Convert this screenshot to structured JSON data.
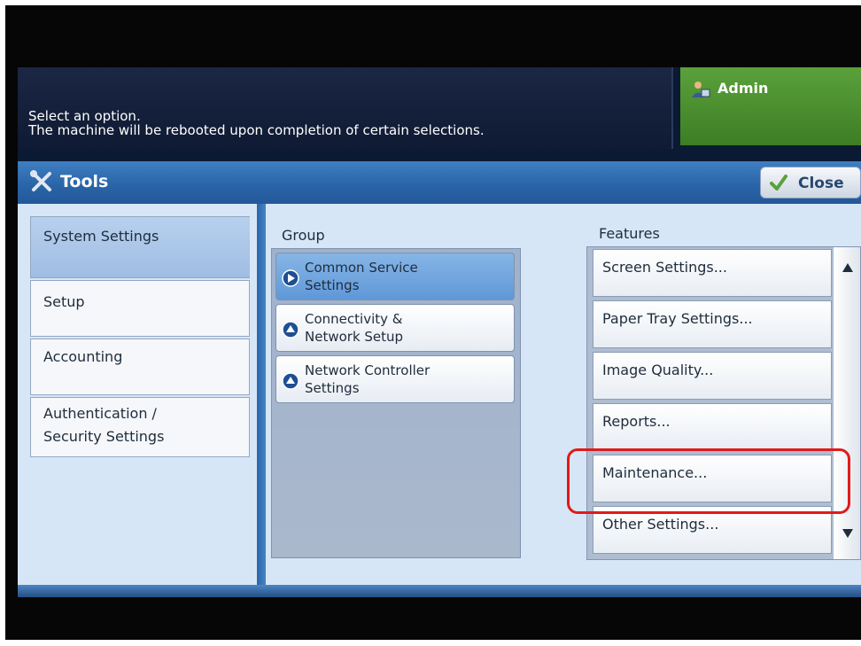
{
  "message": {
    "line1": "Select an option.",
    "line2": "The machine will be rebooted upon completion of certain selections."
  },
  "user": {
    "label": "Admin",
    "icon": "admin-user-icon"
  },
  "titlebar": {
    "title": "Tools",
    "icon": "tools-icon",
    "close_label": "Close",
    "close_icon": "checkmark-icon"
  },
  "tabs": [
    {
      "label": "System Settings",
      "selected": true
    },
    {
      "label": "Setup"
    },
    {
      "label": "Accounting"
    },
    {
      "label": "Authentication / Security Settings",
      "line1": "Authentication /",
      "line2": "Security Settings"
    }
  ],
  "group": {
    "label": "Group",
    "items": [
      {
        "line1": "Common Service",
        "line2": "Settings",
        "selected": true
      },
      {
        "line1": "Connectivity &",
        "line2": "Network Setup"
      },
      {
        "line1": "Network Controller",
        "line2": "Settings"
      }
    ]
  },
  "features": {
    "label": "Features",
    "items": [
      {
        "label": "Screen Settings..."
      },
      {
        "label": "Paper Tray Settings..."
      },
      {
        "label": "Image Quality..."
      },
      {
        "label": "Reports..."
      },
      {
        "label": "Maintenance...",
        "highlighted": true
      },
      {
        "label": "Other Settings..."
      }
    ]
  },
  "colors": {
    "title_bar": "#2a65a8",
    "admin_green": "#4f9530",
    "highlight_red": "#e01a1a",
    "selected_blue": "#6fa4dd"
  }
}
